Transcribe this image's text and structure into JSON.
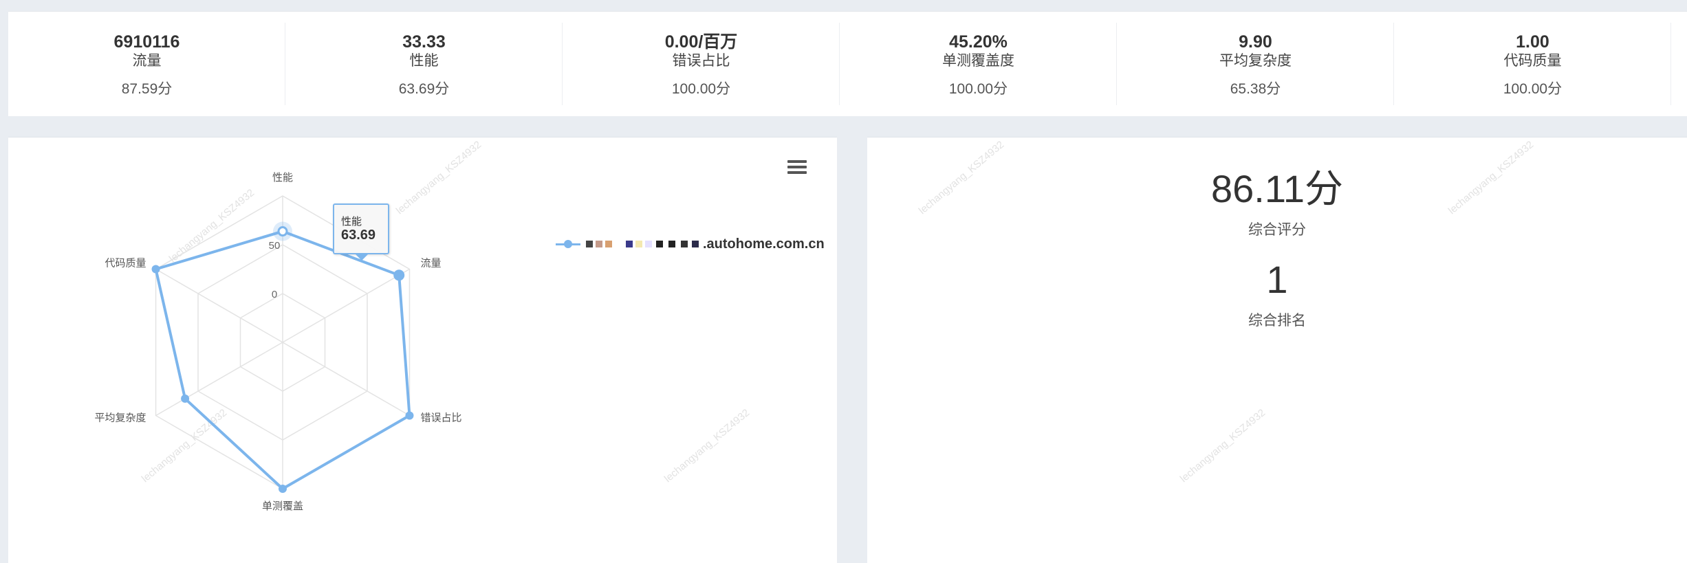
{
  "stats": [
    {
      "value": "6910116",
      "label": "流量",
      "score": "87.59分"
    },
    {
      "value": "33.33",
      "label": "性能",
      "score": "63.69分"
    },
    {
      "value": "0.00/百万",
      "label": "错误占比",
      "score": "100.00分"
    },
    {
      "value": "45.20%",
      "label": "单测覆盖度",
      "score": "100.00分"
    },
    {
      "value": "9.90",
      "label": "平均复杂度",
      "score": "65.38分"
    },
    {
      "value": "1.00",
      "label": "代码质量",
      "score": "100.00分"
    }
  ],
  "chart_data": {
    "type": "radar",
    "axes": [
      "性能",
      "流量",
      "错误占比",
      "单测覆盖",
      "平均复杂度",
      "代码质量"
    ],
    "axis_tick_labels": [
      "0",
      "50"
    ],
    "range": [
      -50,
      100
    ],
    "series": [
      {
        "name": ".autohome.com.cn",
        "values": [
          63.69,
          87.59,
          100,
          100,
          65.38,
          100
        ]
      }
    ],
    "tooltip": {
      "name": "性能",
      "value": "63.69"
    },
    "legend_placement": "right",
    "series_color": "#7cb5ec"
  },
  "summary": {
    "score_value": "86.11分",
    "score_label": "综合评分",
    "rank_value": "1",
    "rank_label": "综合排名"
  },
  "watermark_text": "lechangyang_KSZ4932"
}
